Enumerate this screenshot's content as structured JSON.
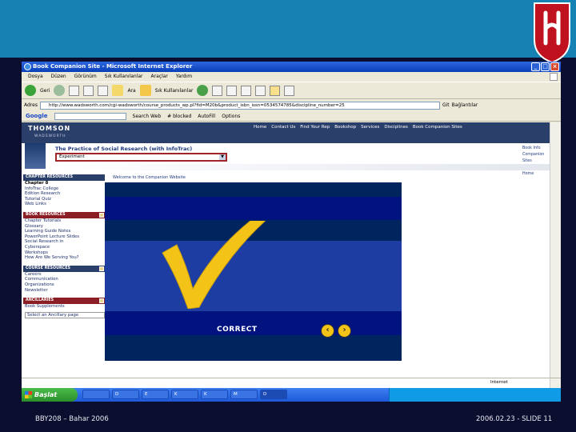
{
  "slide": {
    "footer_left": "BBY208 – Bahar 2006",
    "footer_right": "2006.02.23 - SLIDE 11"
  },
  "browser": {
    "window_title": "Book Companion Site - Microsoft Internet Explorer",
    "menu": [
      "Dosya",
      "Düzen",
      "Görünüm",
      "Sık Kullanılanlar",
      "Araçlar",
      "Yardım"
    ],
    "back_label": "Geri",
    "search_label": "Ara",
    "favorites_label": "Sık Kullanılanlar",
    "address_label": "Adres",
    "address_value": "http://www.wadsworth.com/cgi-wadsworth/course_products_wp.pl?fid=M20b&product_isbn_issn=0534574785&discipline_number=25",
    "go_label": "Git",
    "links_label": "Bağlantılar",
    "google_label": "Google",
    "google_search_label": "Search Web",
    "popup_blocked": "# blocked",
    "autofill": "AutoFill",
    "options": "Options",
    "status_internet": "Internet"
  },
  "site": {
    "brand": "THOMSON",
    "brand_sub": "WADSWORTH",
    "nav": [
      "Home",
      "Contact Us",
      "Find Your Rep",
      "Bookshop",
      "Services",
      "Disciplines",
      "Book Companion Sites"
    ],
    "book_title": "The Practice of Social Research (with InfoTrac)",
    "select_value": "Experiment",
    "right_links": [
      "Book Info",
      "Companion Sites",
      "Spanish Home"
    ],
    "top_strip": "Welcome to the Companion Website"
  },
  "sidebar": {
    "chapter_header": "CHAPTER RESOURCES",
    "chapter_items": [
      "Chapter 8",
      "InfoTrac College",
      "Edition Research",
      "Tutorial Quiz",
      "Web Links"
    ],
    "book_header": "BOOK RESOURCES",
    "book_items": [
      "Chapter Tutorials",
      "Glossary",
      "Learning Guide Notes",
      "PowerPoint Lecture Slides",
      "Social Research in",
      "Cyberspace",
      "Workshops",
      "How Are We Serving You?"
    ],
    "course_header": "COURSE RESOURCES",
    "course_items": [
      "Careers",
      "Communication",
      "Organizations",
      "Newsletter"
    ],
    "ancillaries_header": "ANCILLARIES",
    "ancillaries_items": [
      "Book Supplements"
    ],
    "ancillaries_select": "Select an Ancillary page"
  },
  "quiz": {
    "result": "CORRECT",
    "prev_symbol": "‹",
    "next_symbol": "›"
  },
  "taskbar": {
    "start_label": "Başlat",
    "tasks": [
      "",
      "D",
      "E",
      "K",
      "K",
      "M",
      "D",
      "D"
    ],
    "check_color": "#f4c318"
  }
}
